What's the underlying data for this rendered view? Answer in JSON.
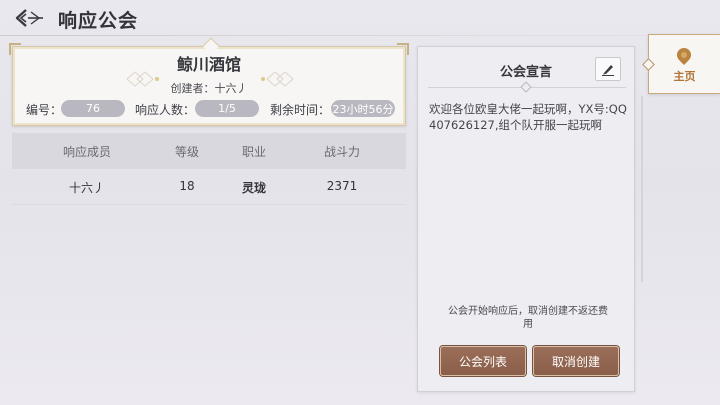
{
  "header": {
    "title": "响应公会"
  },
  "guild": {
    "name": "鲸川酒馆",
    "creator": "创建者：十六丿",
    "id_label": "编号：",
    "id_value": "76",
    "responders_label": "响应人数：",
    "responders_value": "1/5",
    "remaining_label": "剩余时间：",
    "remaining_value": "23小时56分"
  },
  "members_table": {
    "headers": [
      "响应成员",
      "等级",
      "职业",
      "战斗力"
    ],
    "rows": [
      {
        "name": "十六丿",
        "level": "18",
        "class": "灵珑",
        "power": "2371"
      }
    ]
  },
  "notice": {
    "title": "公会宣言",
    "content": "欢迎各位欧皇大佬一起玩啊，YX号:QQ407626127,组个队开服一起玩啊",
    "hint": "公会开始响应后，取消创建不返还费用",
    "list_button": "公会列表",
    "cancel_button": "取消创建"
  },
  "side_tab": {
    "home_label": "主页"
  },
  "colors": {
    "accent_brown": "#8a5e49",
    "gold_border": "#d7c9a6",
    "home_text": "#b07438"
  }
}
